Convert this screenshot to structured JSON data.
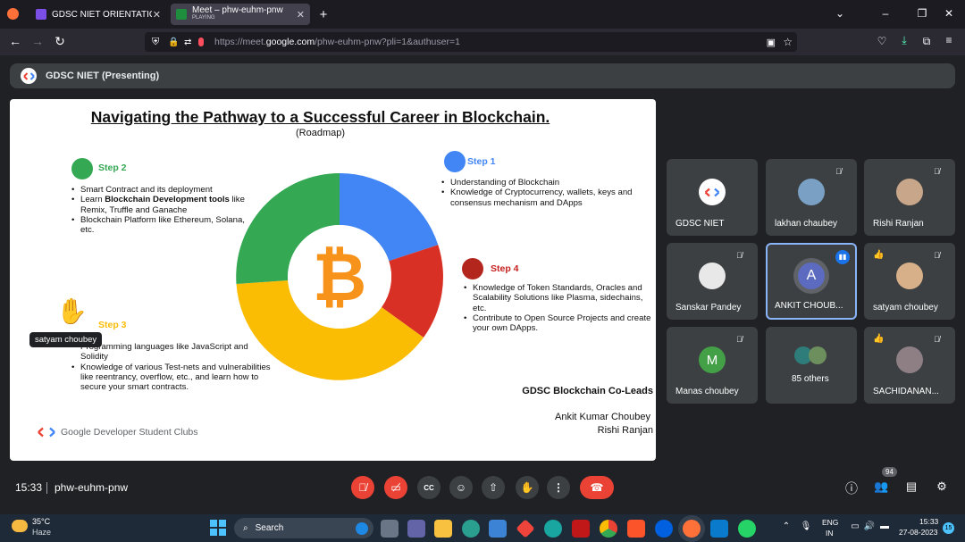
{
  "browser": {
    "tabs": [
      {
        "label": "GDSC NIET ORIENTATION :] - P...",
        "color": "#7b4ee6",
        "active": false
      },
      {
        "label": "Meet – phw-euhm-pnw",
        "sublabel": "PLAYING",
        "color": "#1e8e3e",
        "active": true
      }
    ],
    "url_prefix": "https://meet.",
    "url_domain": "google.com",
    "url_rest": "/phw-euhm-pnw?pli=1&authuser=1"
  },
  "presenting": {
    "label": "GDSC NIET (Presenting)"
  },
  "slide": {
    "title": "Navigating the Pathway to a Successful Career in Blockchain.",
    "subtitle": "(Roadmap)",
    "steps": [
      {
        "label": "Step 2",
        "color": "#34a853",
        "items": [
          "Smart Contract and its deployment",
          "Learn Blockchain Development tools like Remix, Truffle and Ganache",
          "Blockchain Platform like Ethereum, Solana, etc."
        ]
      },
      {
        "label": "Step 1",
        "color": "#4285f4",
        "items": [
          "Understanding of Blockchain",
          "Knowledge of Cryptocurrency, wallets,  keys and consensus mechanism and DApps"
        ]
      },
      {
        "label": "Step 4",
        "color": "#d93025",
        "items": [
          "Knowledge of Token Standards, Oracles and Scalability Solutions like Plasma, sidechains, etc.",
          "Contribute to Open Source Projects and create your own DApps."
        ]
      },
      {
        "label": "Step 3",
        "color": "#fbbc04",
        "items": [
          "Programming languages like JavaScript and Solidity",
          "Knowledge of various Test-nets and vulnerabilities like reentrancy, overflow, etc., and learn how to secure your smart contracts."
        ]
      }
    ],
    "bold_phrase": "Blockchain Development tools",
    "leads_title": "GDSC Blockchain Co-Leads",
    "leads": [
      "Ankit Kumar Choubey",
      "Rishi Ranjan"
    ],
    "footer_logo": "Google Developer Student Clubs",
    "bitcoin_symbol": "₿",
    "hover_label": "satyam choubey"
  },
  "participants": [
    {
      "name": "GDSC NIET",
      "avatar": "logo",
      "muted": false
    },
    {
      "name": "lakhan chaubey",
      "avatar": "photo",
      "color": "#7aa0c4",
      "muted": true
    },
    {
      "name": "Rishi Ranjan",
      "avatar": "photo",
      "color": "#c8a68a",
      "muted": true
    },
    {
      "name": "Sanskar Pandey",
      "avatar": "photo",
      "color": "#e8e8e8",
      "muted": true
    },
    {
      "name": "ANKIT CHOUB...",
      "avatar": "letter",
      "letter": "A",
      "color": "#5c6bc0",
      "speaking": true
    },
    {
      "name": "satyam choubey",
      "avatar": "photo",
      "color": "#d7b08a",
      "muted": true,
      "reaction": "👍"
    },
    {
      "name": "Manas choubey",
      "avatar": "letter",
      "letter": "M",
      "color": "#43a047",
      "muted": true
    },
    {
      "name": "85 others",
      "avatar": "group",
      "muted": false
    },
    {
      "name": "SACHIDANAN...",
      "avatar": "photo",
      "color": "#8d7f84",
      "muted": true,
      "reaction": "👍"
    }
  ],
  "meeting": {
    "time": "15:33",
    "code": "phw-euhm-pnw",
    "people_count": "94"
  },
  "taskbar": {
    "weather_temp": "35°C",
    "weather_desc": "Haze",
    "search": "Search",
    "lang1": "ENG",
    "lang2": "IN",
    "clock_time": "15:33",
    "clock_date": "27-08-2023",
    "notif": "15"
  }
}
